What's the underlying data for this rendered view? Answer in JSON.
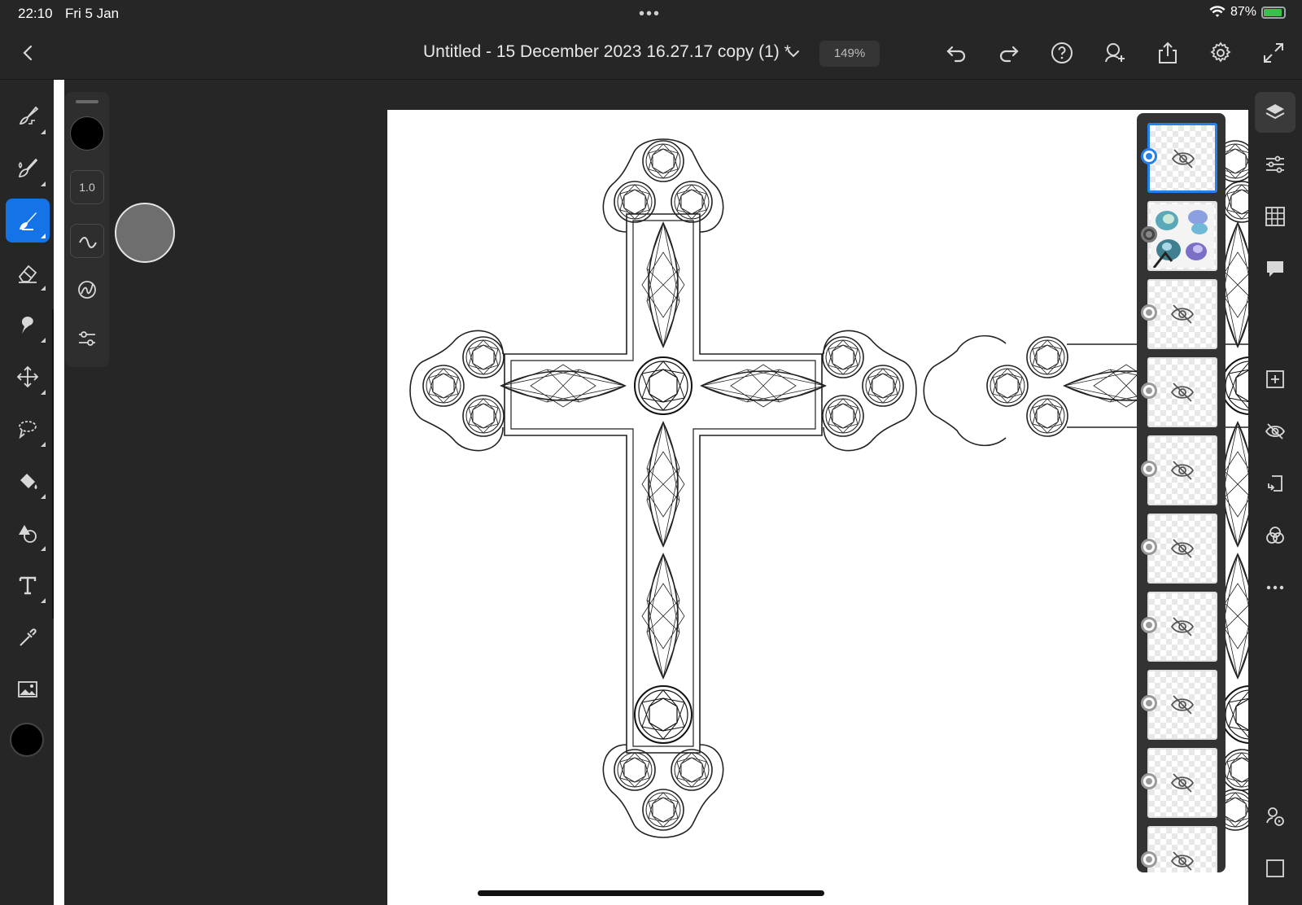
{
  "status_bar": {
    "time": "22:10",
    "date": "Fri 5 Jan",
    "battery_text": "87%"
  },
  "top_bar": {
    "title": "Untitled - 15 December 2023 16.27.17 copy (1) *",
    "zoom": "149%"
  },
  "properties_panel": {
    "brush_size": "1.0"
  },
  "left_tools": [
    {
      "name": "pixel-brush"
    },
    {
      "name": "live-brush"
    },
    {
      "name": "vector-brush",
      "active": true
    },
    {
      "name": "eraser"
    },
    {
      "name": "smudge"
    },
    {
      "name": "transform"
    },
    {
      "name": "selection"
    },
    {
      "name": "fill"
    },
    {
      "name": "shape"
    },
    {
      "name": "type"
    },
    {
      "name": "eyedropper"
    },
    {
      "name": "place-image"
    }
  ],
  "layers": [
    {
      "selected": true,
      "hidden": true
    },
    {
      "selected": false,
      "hidden": false,
      "photo": true
    },
    {
      "selected": false,
      "hidden": true
    },
    {
      "selected": false,
      "hidden": true
    },
    {
      "selected": false,
      "hidden": true
    },
    {
      "selected": false,
      "hidden": true
    },
    {
      "selected": false,
      "hidden": true
    },
    {
      "selected": false,
      "hidden": true
    },
    {
      "selected": false,
      "hidden": true
    },
    {
      "selected": false,
      "hidden": true
    }
  ],
  "colors": {
    "accent": "#1473e6",
    "selection": "#2680eb",
    "battery": "#39c24a"
  }
}
